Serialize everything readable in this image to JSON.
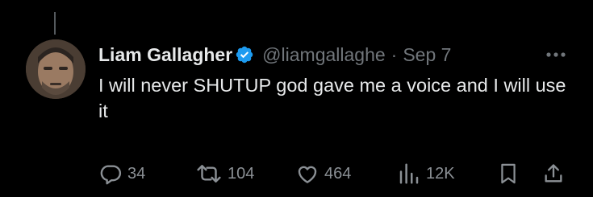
{
  "tweet": {
    "author_name": "Liam Gallagher",
    "handle": "@liamgallaghe",
    "separator": "·",
    "date": "Sep 7",
    "text": "I will never SHUTUP god gave me a voice and I will use it",
    "verified": true
  },
  "actions": {
    "replies": "34",
    "reposts": "104",
    "likes": "464",
    "views": "12K"
  },
  "icons": {
    "reply": "reply-icon",
    "repost": "repost-icon",
    "like": "heart-icon",
    "views": "views-icon",
    "bookmark": "bookmark-icon",
    "share": "share-icon",
    "more": "more-icon",
    "verified": "verified-badge-icon"
  },
  "colors": {
    "background": "#000000",
    "text": "#e7e9ea",
    "muted": "#71767b",
    "verified": "#1d9bf0"
  }
}
